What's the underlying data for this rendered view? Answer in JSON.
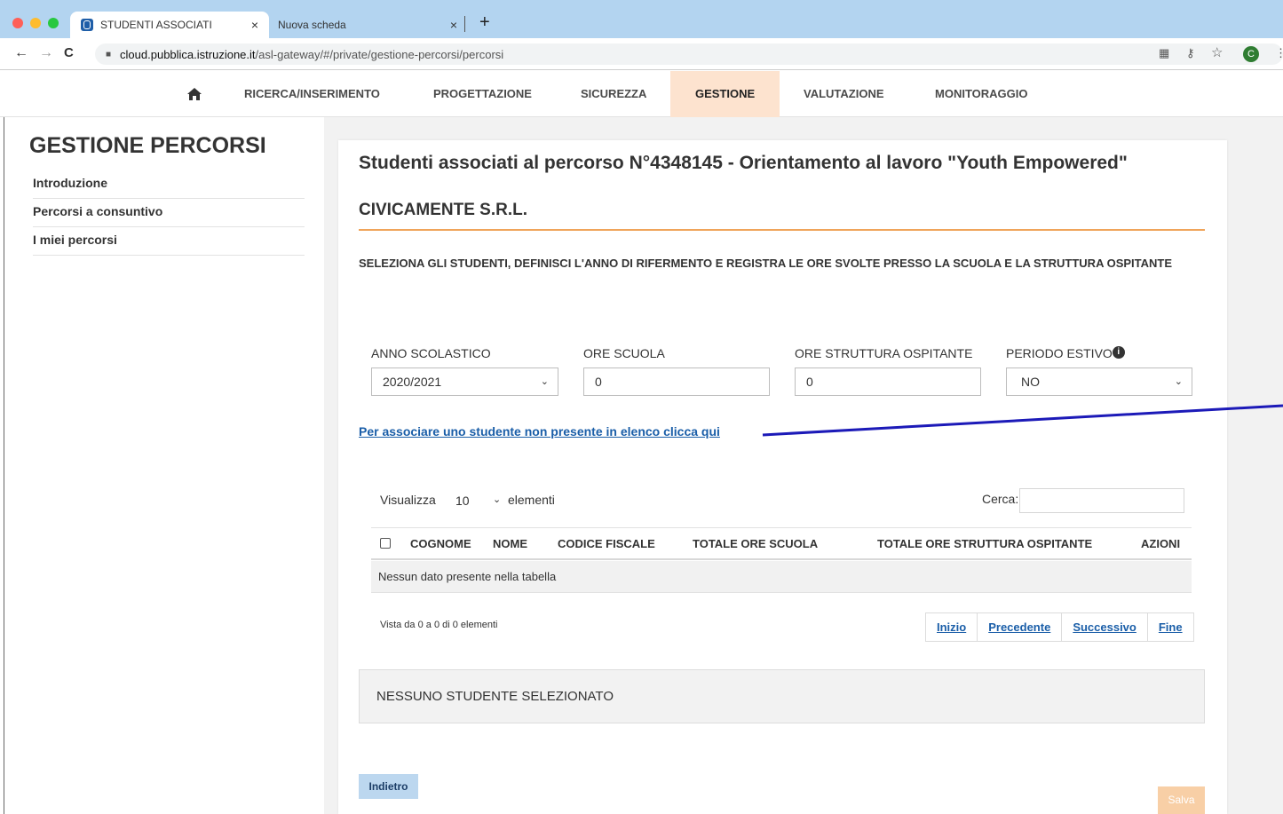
{
  "browser": {
    "tabs": [
      {
        "label": "STUDENTI ASSOCIATI",
        "close": "×"
      },
      {
        "label": "Nuova scheda",
        "close": "×"
      }
    ],
    "new_tab": "+",
    "url_host": "cloud.pubblica.istruzione.it",
    "url_path": "/asl-gateway/#/private/gestione-percorsi/percorsi",
    "profile_initial": "C"
  },
  "topmenu": {
    "items": [
      "RICERCA/INSERIMENTO",
      "PROGETTAZIONE",
      "SICUREZZA",
      "GESTIONE",
      "VALUTAZIONE",
      "MONITORAGGIO"
    ],
    "active": "GESTIONE"
  },
  "sidebar": {
    "title": "GESTIONE PERCORSI",
    "items": [
      "Introduzione",
      "Percorsi a consuntivo",
      "I miei percorsi"
    ]
  },
  "main": {
    "title": "Studenti associati al percorso N°4348145 - Orientamento al lavoro \"Youth Empowered\"",
    "company": "CIVICAMENTE S.R.L.",
    "instructions": "SELEZIONA GLI STUDENTI, DEFINISCI L'ANNO DI RIFERMENTO E REGISTRA LE ORE SVOLTE PRESSO LA SCUOLA E LA STRUTTURA OSPITANTE",
    "fields": {
      "anno_label": "ANNO SCOLASTICO",
      "anno_value": "2020/2021",
      "ore_scuola_label": "ORE SCUOLA",
      "ore_scuola_value": "0",
      "ore_struttura_label": "ORE STRUTTURA OSPITANTE",
      "ore_struttura_value": "0",
      "periodo_label": "PERIODO ESTIVO",
      "periodo_value": "NO"
    },
    "assoc_link": "Per associare uno studente non presente in elenco clicca qui",
    "table": {
      "show_label": "Visualizza",
      "page_length": "10",
      "elements_label": "elementi",
      "search_label": "Cerca:",
      "columns": [
        "COGNOME",
        "NOME",
        "CODICE FISCALE",
        "TOTALE ORE SCUOLA",
        "TOTALE ORE STRUTTURA OSPITANTE",
        "AZIONI"
      ],
      "empty_message": "Nessun dato presente nella tabella",
      "info": "Vista da 0 a 0 di 0 elementi",
      "pager": [
        "Inizio",
        "Precedente",
        "Successivo",
        "Fine"
      ]
    },
    "no_selection": "NESSUNO STUDENTE SELEZIONATO",
    "back_button": "Indietro",
    "save_button": "Salva"
  },
  "colors": {
    "tabbar": "#b3d4f0",
    "active_menu": "#fde3cf",
    "link": "#1a5ea8",
    "rule": "#f0a45a",
    "annotation_line": "#1c1ab8"
  }
}
